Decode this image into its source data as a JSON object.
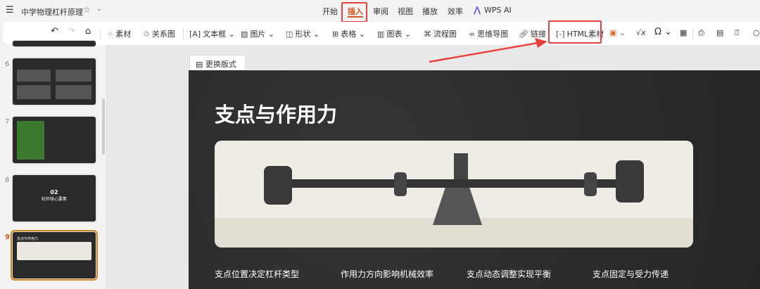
{
  "titlebar": {
    "doc_title": "中学物理杠杆原理",
    "tabs": [
      "开始",
      "插入",
      "审阅",
      "视图",
      "播放",
      "效率",
      "WPS AI"
    ],
    "active_tab": "插入"
  },
  "toolbar": {
    "items": [
      "素材",
      "关系图",
      "文本框",
      "图片",
      "形状",
      "表格",
      "图表",
      "流程图",
      "思维导图",
      "链接",
      "HTML素材"
    ]
  },
  "slides_panel": {
    "thumbs": [
      {
        "num": "6"
      },
      {
        "num": "7"
      },
      {
        "num": "8",
        "text1": "02",
        "text2": "杠杆核心要素"
      },
      {
        "num": "9",
        "title": "支点与作用力"
      }
    ],
    "selected": "9"
  },
  "editor": {
    "change_layout": "更换版式"
  },
  "slide": {
    "title": "支点与作用力",
    "points": [
      "支点位置决定杠杆类型",
      "作用力方向影响机械效率",
      "支点动态调整实现平衡",
      "支点固定与受力传递"
    ]
  },
  "colors": {
    "accent": "#d4561e",
    "highlight": "#e8423f"
  }
}
